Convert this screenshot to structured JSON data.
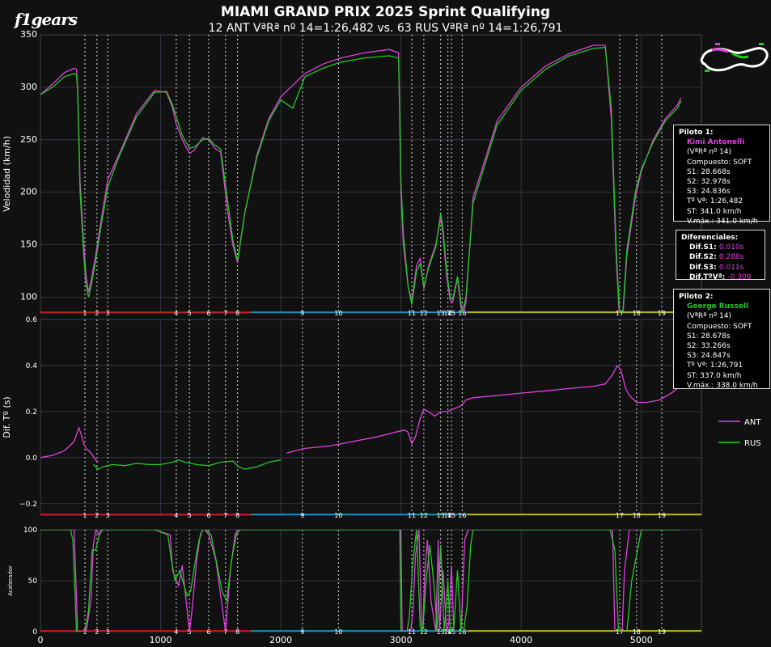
{
  "header": {
    "logo_text": "f1gears",
    "title": "MIAMI GRAND PRIX 2025 Sprint Qualifying",
    "subtitle": "12 ANT VªRª nº  14=1:26,482 vs. 63 RUS VªRª nº  14=1:26,791"
  },
  "colors": {
    "background": "#111111",
    "driver1": "#e040e0",
    "driver2": "#22c922",
    "sector1": "#e01818",
    "sector2": "#1aa0d8",
    "sector3": "#d8d820",
    "grid": "#3a3f4a"
  },
  "driver1_box": {
    "header": "Piloto 1:",
    "name": "Kimi Antonelli",
    "lines": [
      "(VªRª nº 14)",
      "Compuesto: SOFT",
      "S1: 28.668s",
      "S2: 32.978s",
      "S3: 24.836s",
      "Tº Vª: 1:26,482",
      "ST: 341.0 km/h",
      "V.máx.: 341.0 km/h"
    ]
  },
  "diff_box": {
    "header": "Diferenciales:",
    "rows": [
      {
        "label": "Dif.S1:",
        "value": "0.010s"
      },
      {
        "label": "Dif.S2:",
        "value": "0.288s"
      },
      {
        "label": "Dif.S3:",
        "value": "0.011s"
      },
      {
        "label": "Dif.TºVª:",
        "value": "-0.309"
      }
    ]
  },
  "driver2_box": {
    "header": "Piloto 2:",
    "name": "George Russell",
    "lines": [
      "(VªRª nº 14)",
      "Compuesto: SOFT",
      "S1: 28.678s",
      "S2: 33.266s",
      "S3: 24.847s",
      "Tº Vª: 1:26,791",
      "ST: 337.0 km/h",
      "V.máx.: 338.0 km/h"
    ]
  },
  "chart_data": {
    "type": "line",
    "xlim": [
      0,
      5500
    ],
    "x_ticks": [
      0,
      1000,
      2000,
      3000,
      4000,
      5000
    ],
    "corners": [
      {
        "label": "1",
        "x": 370
      },
      {
        "label": "2",
        "x": 470
      },
      {
        "label": "3",
        "x": 560
      },
      {
        "label": "4",
        "x": 1130
      },
      {
        "label": "5",
        "x": 1240
      },
      {
        "label": "6",
        "x": 1400
      },
      {
        "label": "7",
        "x": 1540
      },
      {
        "label": "8",
        "x": 1640
      },
      {
        "label": "9",
        "x": 2180
      },
      {
        "label": "10",
        "x": 2480
      },
      {
        "label": "11",
        "x": 3090
      },
      {
        "label": "12",
        "x": 3190
      },
      {
        "label": "13",
        "x": 3330
      },
      {
        "label": "14",
        "x": 3390
      },
      {
        "label": "15",
        "x": 3420
      },
      {
        "label": "16",
        "x": 3510
      },
      {
        "label": "17",
        "x": 4820
      },
      {
        "label": "18",
        "x": 4960
      },
      {
        "label": "19",
        "x": 5170
      }
    ],
    "sectors": [
      {
        "from": 0,
        "to": 1750,
        "color": "#e01818"
      },
      {
        "from": 1750,
        "to": 3550,
        "color": "#1aa0d8"
      },
      {
        "from": 3550,
        "to": 5500,
        "color": "#d8d820"
      }
    ],
    "speed": {
      "ylabel": "Velodidad (km/h)",
      "ylim": [
        85,
        350
      ],
      "y_ticks": [
        100,
        150,
        200,
        250,
        300,
        350
      ],
      "series": [
        {
          "name": "ANT",
          "x": [
            0,
            100,
            200,
            280,
            300,
            310,
            330,
            360,
            380,
            400,
            420,
            460,
            500,
            560,
            650,
            800,
            950,
            1050,
            1100,
            1130,
            1180,
            1240,
            1280,
            1350,
            1400,
            1450,
            1500,
            1560,
            1600,
            1640,
            1700,
            1800,
            1900,
            2000,
            2100,
            2200,
            2350,
            2500,
            2700,
            2900,
            2980,
            3000,
            3020,
            3060,
            3090,
            3130,
            3160,
            3190,
            3230,
            3290,
            3330,
            3350,
            3380,
            3410,
            3430,
            3470,
            3510,
            3540,
            3600,
            3800,
            4000,
            4200,
            4400,
            4600,
            4700,
            4750,
            4790,
            4820,
            4840,
            4880,
            4950,
            5000,
            5100,
            5200,
            5300,
            5330
          ],
          "y": [
            293,
            303,
            314,
            318,
            317,
            300,
            210,
            150,
            120,
            105,
            115,
            140,
            170,
            212,
            235,
            275,
            297,
            295,
            280,
            265,
            250,
            237,
            240,
            252,
            250,
            242,
            238,
            180,
            150,
            133,
            180,
            235,
            270,
            291,
            302,
            313,
            322,
            328,
            333,
            336,
            333,
            200,
            150,
            110,
            97,
            130,
            137,
            108,
            130,
            150,
            175,
            160,
            120,
            97,
            95,
            118,
            80,
            95,
            195,
            268,
            300,
            320,
            332,
            340,
            340,
            270,
            140,
            75,
            72,
            140,
            195,
            220,
            250,
            270,
            283,
            290
          ]
        },
        {
          "name": "RUS",
          "x": [
            0,
            100,
            200,
            280,
            300,
            310,
            330,
            360,
            380,
            400,
            420,
            460,
            500,
            560,
            650,
            800,
            950,
            1050,
            1100,
            1130,
            1180,
            1240,
            1280,
            1350,
            1400,
            1450,
            1500,
            1560,
            1600,
            1640,
            1700,
            1800,
            1900,
            2000,
            2100,
            2200,
            2350,
            2500,
            2700,
            2900,
            2980,
            3000,
            3020,
            3060,
            3090,
            3130,
            3160,
            3190,
            3230,
            3290,
            3330,
            3350,
            3380,
            3410,
            3430,
            3470,
            3510,
            3540,
            3600,
            3800,
            4000,
            4200,
            4400,
            4600,
            4700,
            4750,
            4790,
            4820,
            4840,
            4880,
            4950,
            5000,
            5100,
            5200,
            5300,
            5330
          ],
          "y": [
            293,
            300,
            310,
            313,
            312,
            296,
            200,
            140,
            112,
            100,
            110,
            135,
            165,
            205,
            233,
            272,
            295,
            296,
            283,
            272,
            254,
            242,
            243,
            250,
            251,
            245,
            241,
            190,
            155,
            135,
            180,
            233,
            268,
            288,
            280,
            310,
            318,
            324,
            328,
            330,
            328,
            210,
            160,
            110,
            93,
            125,
            132,
            110,
            128,
            148,
            180,
            165,
            125,
            100,
            98,
            120,
            85,
            100,
            190,
            264,
            297,
            317,
            330,
            337,
            338,
            280,
            150,
            80,
            75,
            145,
            200,
            222,
            248,
            268,
            280,
            287
          ]
        }
      ]
    },
    "delta": {
      "ylabel": "Dif. Tº (s)",
      "ylim": [
        -0.25,
        0.6
      ],
      "y_ticks": [
        -0.2,
        0,
        0.2,
        0.4,
        0.6
      ],
      "legend": [
        "ANT",
        "RUS"
      ],
      "series": [
        {
          "name": "ANT",
          "x": [
            0,
            100,
            200,
            280,
            320,
            340,
            360,
            380,
            420,
            460,
            480
          ],
          "y": [
            0,
            0.01,
            0.03,
            0.07,
            0.13,
            0.1,
            0.06,
            0.04,
            0.02,
            -0.01,
            -0.02
          ]
        },
        {
          "name": "RUS",
          "x": [
            440,
            480,
            520,
            600,
            700,
            800,
            900,
            1000,
            1100,
            1150,
            1200,
            1300,
            1400,
            1500,
            1600,
            1650,
            1700,
            1800,
            1900,
            2000
          ],
          "y": [
            -0.03,
            -0.05,
            -0.04,
            -0.03,
            -0.035,
            -0.025,
            -0.03,
            -0.03,
            -0.02,
            -0.01,
            -0.02,
            -0.03,
            -0.035,
            -0.02,
            -0.015,
            -0.04,
            -0.05,
            -0.04,
            -0.02,
            -0.01
          ]
        },
        {
          "name": "ANT",
          "x": [
            2050,
            2200,
            2400,
            2600,
            2800,
            2950,
            3030,
            3060,
            3090,
            3120,
            3160,
            3190,
            3230,
            3280,
            3330,
            3390,
            3430,
            3480,
            3510,
            3540,
            3600,
            3800,
            4000,
            4200,
            4400,
            4600,
            4700,
            4760,
            4800,
            4830,
            4870,
            4900,
            4960,
            5050,
            5150,
            5250,
            5300,
            5330
          ],
          "y": [
            0.02,
            0.04,
            0.05,
            0.07,
            0.09,
            0.11,
            0.12,
            0.11,
            0.06,
            0.09,
            0.17,
            0.21,
            0.2,
            0.18,
            0.2,
            0.2,
            0.21,
            0.22,
            0.23,
            0.25,
            0.26,
            0.27,
            0.28,
            0.29,
            0.3,
            0.31,
            0.32,
            0.36,
            0.4,
            0.38,
            0.3,
            0.27,
            0.24,
            0.24,
            0.25,
            0.28,
            0.3,
            0.31
          ]
        }
      ]
    },
    "throttle": {
      "ylabel": "Acelerador",
      "ylim": [
        0,
        100
      ],
      "y_ticks": [
        0,
        50,
        100
      ],
      "series": [
        {
          "name": "ANT",
          "x": [
            0,
            240,
            260,
            280,
            310,
            360,
            380,
            420,
            440,
            460,
            490,
            520,
            560,
            650,
            950,
            1080,
            1100,
            1150,
            1180,
            1240,
            1260,
            1300,
            1330,
            1350,
            1370,
            1400,
            1460,
            1500,
            1540,
            1580,
            1620,
            1640,
            1670,
            2000,
            2900,
            3000,
            3010,
            3060,
            3080,
            3100,
            3120,
            3150,
            3170,
            3180,
            3200,
            3220,
            3250,
            3290,
            3310,
            3320,
            3350,
            3380,
            3400,
            3420,
            3440,
            3480,
            3500,
            3510,
            3530,
            3560,
            3600,
            4000,
            4760,
            4780,
            4820,
            4840,
            4860,
            4900,
            5000,
            5300,
            5330
          ],
          "y": [
            100,
            100,
            100,
            100,
            0,
            0,
            0,
            30,
            85,
            100,
            95,
            100,
            100,
            100,
            100,
            95,
            60,
            45,
            65,
            0,
            20,
            70,
            95,
            100,
            100,
            95,
            70,
            35,
            0,
            60,
            95,
            100,
            100,
            100,
            100,
            100,
            0,
            0,
            0,
            20,
            75,
            100,
            10,
            0,
            60,
            90,
            30,
            0,
            90,
            0,
            60,
            0,
            10,
            65,
            0,
            0,
            0,
            30,
            90,
            100,
            100,
            100,
            100,
            0,
            0,
            0,
            60,
            100,
            100,
            100,
            100
          ]
        },
        {
          "name": "RUS",
          "x": [
            0,
            230,
            250,
            270,
            300,
            350,
            370,
            400,
            430,
            460,
            500,
            540,
            560,
            640,
            950,
            1060,
            1090,
            1120,
            1160,
            1220,
            1250,
            1290,
            1320,
            1350,
            1380,
            1420,
            1470,
            1510,
            1550,
            1590,
            1630,
            1660,
            2000,
            2950,
            2990,
            3000,
            3050,
            3070,
            3100,
            3130,
            3160,
            3180,
            3210,
            3240,
            3280,
            3300,
            3330,
            3360,
            3390,
            3410,
            3440,
            3470,
            3500,
            3520,
            3550,
            3580,
            3600,
            4000,
            4720,
            4740,
            4780,
            4810,
            4850,
            4880,
            4920,
            5000,
            5300,
            5330
          ],
          "y": [
            100,
            100,
            100,
            90,
            0,
            0,
            0,
            20,
            80,
            80,
            100,
            100,
            100,
            100,
            100,
            95,
            70,
            50,
            60,
            35,
            40,
            70,
            90,
            100,
            100,
            95,
            65,
            40,
            30,
            70,
            95,
            100,
            100,
            100,
            100,
            0,
            0,
            15,
            70,
            100,
            5,
            0,
            50,
            85,
            40,
            0,
            85,
            0,
            50,
            0,
            5,
            60,
            0,
            0,
            25,
            85,
            100,
            100,
            100,
            100,
            80,
            0,
            0,
            0,
            50,
            100,
            100,
            100,
            100
          ]
        }
      ]
    }
  }
}
